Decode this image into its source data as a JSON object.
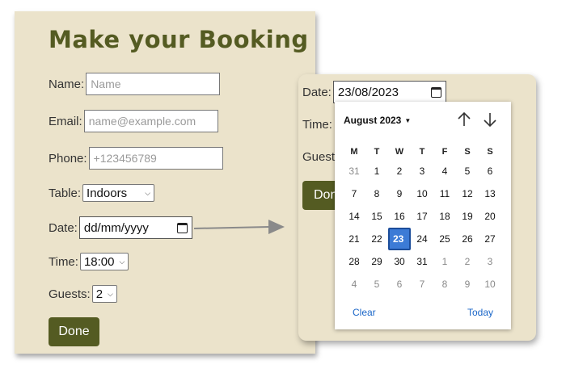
{
  "form": {
    "title": "Make your Booking",
    "name_label": "Name:",
    "name_placeholder": "Name",
    "email_label": "Email:",
    "email_placeholder": "name@example.com",
    "phone_label": "Phone:",
    "phone_placeholder": "+123456789",
    "table_label": "Table:",
    "table_value": "Indoors",
    "date_label": "Date:",
    "date_placeholder": "dd/mm/yyyy",
    "time_label": "Time:",
    "time_value": "18:00",
    "guests_label": "Guests:",
    "guests_value": "2",
    "done_label": "Done"
  },
  "zoom": {
    "date_label": "Date:",
    "date_value": "23/08/2023",
    "time_label": "Time:",
    "guests_label": "Guest",
    "done_label": "Don"
  },
  "calendar": {
    "month_label": "August 2023",
    "weekdays": [
      "M",
      "T",
      "W",
      "T",
      "F",
      "S",
      "S"
    ],
    "weeks": [
      [
        {
          "d": "31",
          "out": true
        },
        {
          "d": "1"
        },
        {
          "d": "2"
        },
        {
          "d": "3"
        },
        {
          "d": "4"
        },
        {
          "d": "5"
        },
        {
          "d": "6"
        }
      ],
      [
        {
          "d": "7"
        },
        {
          "d": "8"
        },
        {
          "d": "9"
        },
        {
          "d": "10"
        },
        {
          "d": "11"
        },
        {
          "d": "12"
        },
        {
          "d": "13"
        }
      ],
      [
        {
          "d": "14"
        },
        {
          "d": "15"
        },
        {
          "d": "16"
        },
        {
          "d": "17"
        },
        {
          "d": "18"
        },
        {
          "d": "19"
        },
        {
          "d": "20"
        }
      ],
      [
        {
          "d": "21"
        },
        {
          "d": "22"
        },
        {
          "d": "23",
          "selected": true
        },
        {
          "d": "24"
        },
        {
          "d": "25"
        },
        {
          "d": "26"
        },
        {
          "d": "27"
        }
      ],
      [
        {
          "d": "28"
        },
        {
          "d": "29"
        },
        {
          "d": "30"
        },
        {
          "d": "31"
        },
        {
          "d": "1",
          "out": true
        },
        {
          "d": "2",
          "out": true
        },
        {
          "d": "3",
          "out": true
        }
      ],
      [
        {
          "d": "4",
          "out": true
        },
        {
          "d": "5",
          "out": true
        },
        {
          "d": "6",
          "out": true
        },
        {
          "d": "7",
          "out": true
        },
        {
          "d": "8",
          "out": true
        },
        {
          "d": "9",
          "out": true
        },
        {
          "d": "10",
          "out": true
        }
      ]
    ],
    "clear_label": "Clear",
    "today_label": "Today"
  },
  "colors": {
    "card_bg": "#ebe3cb",
    "accent": "#545b22",
    "selected_day": "#3c7bd6",
    "link": "#1a66c8"
  },
  "icons": [
    "calendar-icon",
    "chevron-down-icon",
    "arrow-up-icon",
    "arrow-down-icon",
    "pointer-arrow-icon"
  ]
}
